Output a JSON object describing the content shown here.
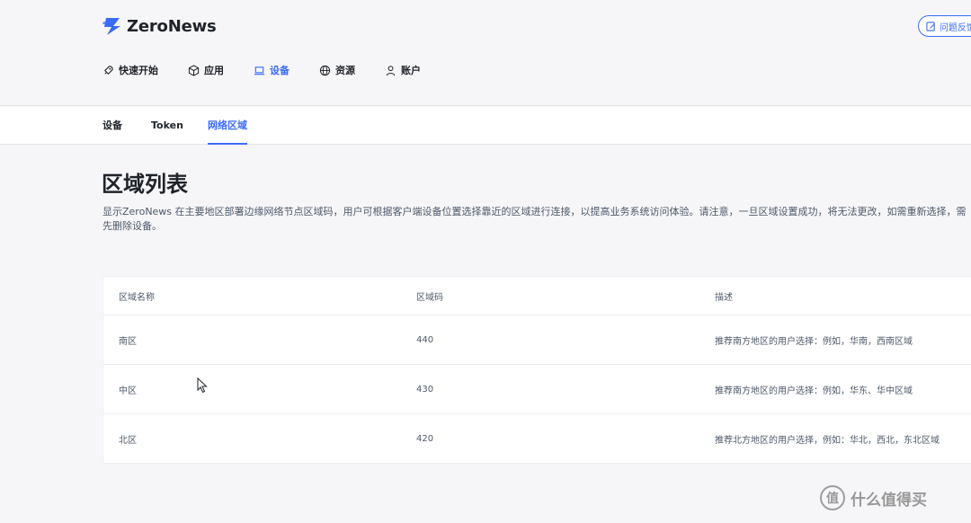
{
  "brand": {
    "name": "ZeroNews",
    "accent": "#3b6cf6",
    "logo_color": "#3b6cf6"
  },
  "header": {
    "feedback_label": "问题反馈",
    "nav": [
      {
        "label": "快速开始",
        "icon": "rocket-icon",
        "active": false
      },
      {
        "label": "应用",
        "icon": "cube-icon",
        "active": false
      },
      {
        "label": "设备",
        "icon": "laptop-icon",
        "active": true
      },
      {
        "label": "资源",
        "icon": "globe-icon",
        "active": false
      },
      {
        "label": "账户",
        "icon": "user-icon",
        "active": false
      }
    ]
  },
  "subnav": {
    "tabs": [
      {
        "label": "设备",
        "active": false
      },
      {
        "label": "Token",
        "active": false
      },
      {
        "label": "网络区域",
        "active": true
      }
    ]
  },
  "main": {
    "title": "区域列表",
    "description": "显示ZeroNews 在主要地区部署边缘网络节点区域码，用户可根据客户端设备位置选择靠近的区域进行连接，以提高业务系统访问体验。请注意，一旦区域设置成功，将无法更改，如需重新选择，需先删除设备。"
  },
  "table": {
    "columns": [
      "区域名称",
      "区域码",
      "描述"
    ],
    "rows": [
      {
        "name": "南区",
        "code": "440",
        "desc": "推荐南方地区的用户选择：例如，华南，西南区域"
      },
      {
        "name": "中区",
        "code": "430",
        "desc": "推荐南方地区的用户选择：例如，华东、华中区域"
      },
      {
        "name": "北区",
        "code": "420",
        "desc": "推荐北方地区的用户选择，例如：华北，西北，东北区域"
      }
    ]
  },
  "watermark": {
    "text": "什么值得买",
    "icon_glyph": "值"
  }
}
